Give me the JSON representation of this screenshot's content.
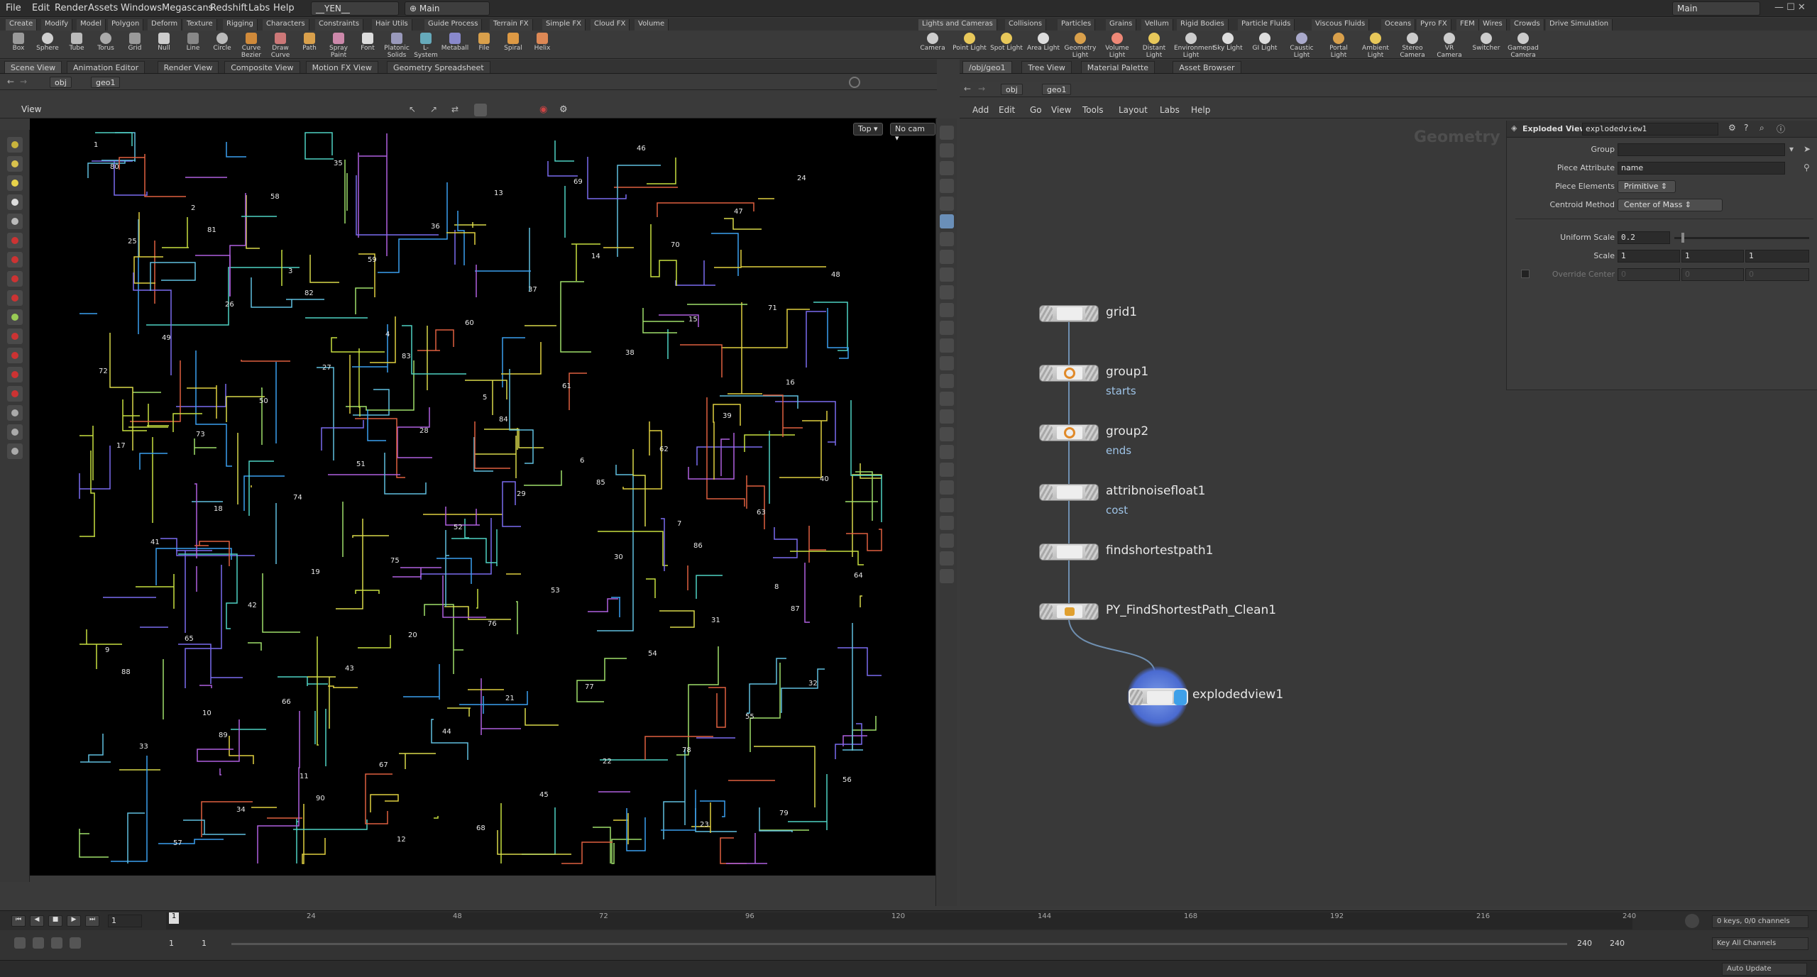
{
  "menubar": {
    "items": [
      "File",
      "Edit",
      "Render",
      "Assets",
      "Windows",
      "Megascans",
      "Redshift",
      "Labs",
      "Help"
    ],
    "project": "__YEN__",
    "desktop_left": "Main",
    "desktop_right": "Main"
  },
  "shelf_tabs_left": [
    "Create",
    "Modify",
    "Model",
    "Polygon",
    "Deform",
    "Texture",
    "Rigging",
    "Characters",
    "Constraints",
    "Hair Utils",
    "Guide Process",
    "Terrain FX",
    "Simple FX",
    "Cloud FX",
    "Volume"
  ],
  "shelf_tabs_right": [
    "Lights and Cameras",
    "Collisions",
    "Particles",
    "Grains",
    "Vellum",
    "Rigid Bodies",
    "Particle Fluids",
    "Viscous Fluids",
    "Oceans",
    "Pyro FX",
    "FEM",
    "Wires",
    "Crowds",
    "Drive Simulation"
  ],
  "shelf_tools_left": [
    "Box",
    "Sphere",
    "Tube",
    "Torus",
    "Grid",
    "Null",
    "Line",
    "Circle",
    "Curve Bezier",
    "Draw Curve",
    "Path",
    "Spray Paint",
    "Font",
    "Platonic Solids",
    "L-System",
    "Metaball",
    "File",
    "Spiral",
    "Helix"
  ],
  "shelf_tools_right": [
    "Camera",
    "Point Light",
    "Spot Light",
    "Area Light",
    "Geometry Light",
    "Volume Light",
    "Distant Light",
    "Environment Light",
    "Sky Light",
    "GI Light",
    "Caustic Light",
    "Portal Light",
    "Ambient Light",
    "Stereo Camera",
    "VR Camera",
    "Switcher",
    "Gamepad Camera"
  ],
  "left_pane_tabs": [
    "Scene View",
    "Animation Editor",
    "Render View",
    "Composite View",
    "Motion FX View",
    "Geometry Spreadsheet"
  ],
  "right_pane_tabs": [
    "/obj/geo1",
    "Tree View",
    "Material Palette",
    "Asset Browser"
  ],
  "left_path": [
    "obj",
    "geo1"
  ],
  "right_path": [
    "obj",
    "geo1"
  ],
  "viewport": {
    "title": "View",
    "view_mode": "Top",
    "camera": "No cam",
    "labels": [
      "1",
      "2",
      "3",
      "4",
      "5",
      "6",
      "7",
      "8",
      "9",
      "10",
      "11",
      "12",
      "13",
      "14",
      "15",
      "16",
      "17",
      "18",
      "19",
      "20",
      "21",
      "22",
      "23",
      "24",
      "25",
      "26",
      "27",
      "28",
      "29",
      "30",
      "31",
      "32",
      "33",
      "34",
      "35",
      "36",
      "37",
      "38",
      "39",
      "40",
      "41",
      "42",
      "43",
      "44",
      "45",
      "46",
      "47",
      "48",
      "49",
      "50",
      "51",
      "52",
      "53",
      "54",
      "55",
      "56",
      "57",
      "58",
      "59",
      "60",
      "61",
      "62",
      "63",
      "64",
      "65",
      "66",
      "67",
      "68",
      "69",
      "70",
      "71",
      "72",
      "73",
      "74",
      "75",
      "76",
      "77",
      "78",
      "79",
      "80",
      "81",
      "82",
      "83",
      "84",
      "85",
      "86",
      "87",
      "88",
      "89",
      "90"
    ]
  },
  "network_menu": [
    "Add",
    "Edit",
    "Go",
    "View",
    "Tools",
    "Layout",
    "Labs",
    "Help"
  ],
  "network_label": "Geometry",
  "nodes": [
    {
      "name": "grid1",
      "sub": ""
    },
    {
      "name": "group1",
      "sub": "starts"
    },
    {
      "name": "group2",
      "sub": "ends"
    },
    {
      "name": "attribnoisefloat1",
      "sub": "cost"
    },
    {
      "name": "findshortestpath1",
      "sub": ""
    },
    {
      "name": "PY_FindShortestPath_Clean1",
      "sub": ""
    },
    {
      "name": "explodedview1",
      "sub": ""
    }
  ],
  "params": {
    "node_type": "Exploded View",
    "node_name": "explodedview1",
    "group_label": "Group",
    "group_value": "",
    "piece_attr_label": "Piece Attribute",
    "piece_attr_value": "name",
    "piece_elem_label": "Piece Elements",
    "piece_elem_value": "Primitive",
    "centroid_label": "Centroid Method",
    "centroid_value": "Center of Mass",
    "uniform_label": "Uniform Scale",
    "uniform_value": "0.2",
    "uniform_fraction": 0.2,
    "scale_label": "Scale",
    "scale_values": [
      "1",
      "1",
      "1"
    ],
    "override_label": "Override Center",
    "override_values": [
      "0",
      "0",
      "0"
    ]
  },
  "timeline": {
    "frame": "1",
    "ticks": [
      "24",
      "48",
      "72",
      "96",
      "120",
      "144",
      "168",
      "192",
      "216",
      "240"
    ],
    "range_start": "1",
    "range_start2": "1",
    "range_end": "240",
    "range_end2": "240",
    "keys_info": "0 keys, 0/0 channels",
    "key_all": "Key All Channels",
    "auto_update": "Auto Update"
  },
  "colors": {
    "viewport_bg": "#000000",
    "node_selected": "#6a8fd8",
    "subtext": "#9ec3e6"
  }
}
